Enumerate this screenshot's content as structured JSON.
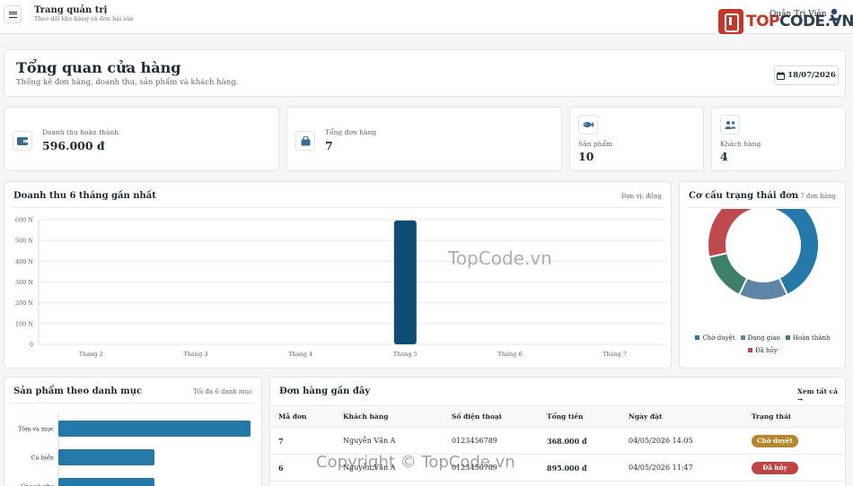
{
  "topbar": {
    "title": "Trang quản trị",
    "subtitle": "Theo dõi kho hàng và đơn hải sản",
    "logo_part1": "TOP",
    "logo_part2": "CODE.VN",
    "user_label": "Quản Trị Viên"
  },
  "hero": {
    "title": "Tổng quan cửa hàng",
    "subtitle": "Thống kê đơn hàng, doanh thu, sản phẩm và khách hàng.",
    "date": "18/07/2026"
  },
  "stats": [
    {
      "label": "Doanh thu hoàn thành",
      "value": "596.000 đ",
      "icon": "wallet-icon"
    },
    {
      "label": "Tổng đơn hàng",
      "value": "7",
      "icon": "shopping-bag-icon"
    },
    {
      "label": "Sản phẩm",
      "value": "10",
      "icon": "fish-icon"
    },
    {
      "label": "Khách hàng",
      "value": "4",
      "icon": "users-icon"
    }
  ],
  "revenue_panel": {
    "title": "Doanh thu 6 tháng gần nhất",
    "note": "Đơn vị: đồng"
  },
  "status_panel": {
    "title": "Cơ cấu trạng thái đơn",
    "note": "7 đơn hàng"
  },
  "category_panel": {
    "title": "Sản phẩm theo danh mục",
    "note": "Tối đa 6 danh mục"
  },
  "orders_panel": {
    "title": "Đơn hàng gần đây",
    "view_all": "Xem tất cả",
    "columns": [
      "Mã đơn",
      "Khách hàng",
      "Số điện thoại",
      "Tổng tiền",
      "Ngày đặt",
      "Trạng thái"
    ],
    "rows": [
      {
        "id": "7",
        "customer": "Nguyễn Văn A",
        "phone": "0123456789",
        "total": "368.000 đ",
        "date": "04/05/2026 14:05",
        "status": "Chờ duyệt",
        "status_color": "#b7862b"
      },
      {
        "id": "6",
        "customer": "Nguyễn Văn A",
        "phone": "0123456789",
        "total": "895.000 đ",
        "date": "04/05/2026 11:47",
        "status": "Đã hủy",
        "status_color": "#bf4444"
      }
    ]
  },
  "watermarks": [
    "TopCode.vn",
    "Copyright © TopCode.vn"
  ],
  "chart_data": [
    {
      "type": "bar",
      "categories": [
        "Tháng 2",
        "Tháng 3",
        "Tháng 4",
        "Tháng 5",
        "Tháng 6",
        "Tháng 7"
      ],
      "values": [
        0,
        0,
        0,
        596000,
        0,
        0
      ],
      "yticks": [
        "0",
        "100 N",
        "200 N",
        "300 N",
        "400 N",
        "500 N",
        "600 N"
      ],
      "ylim": [
        0,
        600000
      ],
      "grid": true,
      "color": "#0f4c75"
    },
    {
      "type": "pie",
      "labels": [
        "Chờ duyệt",
        "Đang giao",
        "Hoàn thành",
        "Đã hủy"
      ],
      "values": [
        3,
        1,
        1,
        2
      ],
      "colors": [
        "#2479a8",
        "#5f85a6",
        "#3d7f6a",
        "#bf4a4e"
      ],
      "legend": "bottom"
    },
    {
      "type": "bar",
      "orientation": "horizontal",
      "categories": [
        "Tôm và mực",
        "Cá biển",
        "Cua và ghẹ"
      ],
      "values": [
        4,
        2,
        2
      ],
      "color": "#2479a8"
    }
  ]
}
